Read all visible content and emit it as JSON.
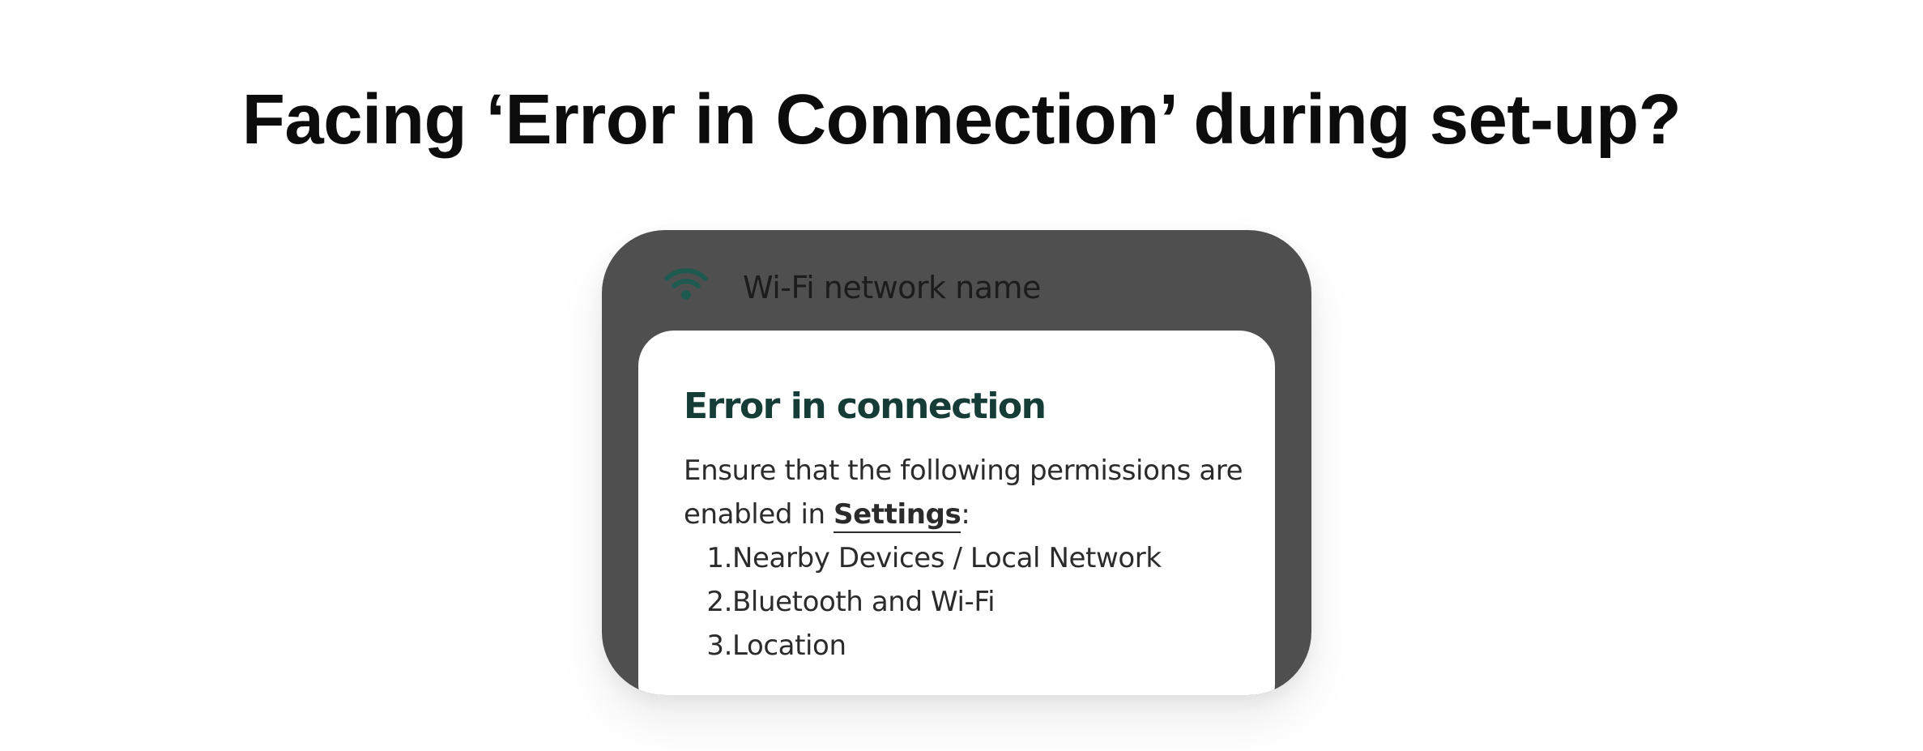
{
  "headline": "Facing ‘Error in Connection’ during set-up?",
  "network": {
    "icon": "wifi-icon",
    "name": "Wi-Fi network name"
  },
  "dialog": {
    "title": "Error in connection",
    "body_prefix": "Ensure that the following permissions are enabled in ",
    "settings_link": "Settings",
    "body_suffix": ":",
    "permissions": [
      {
        "number": "1.",
        "label": "Nearby Devices / Local Network"
      },
      {
        "number": "2.",
        "label": "Bluetooth and Wi-Fi"
      },
      {
        "number": "3.",
        "label": "Location"
      }
    ]
  },
  "colors": {
    "card_background": "#4f4f4f",
    "dialog_background": "#ffffff",
    "title_color": "#153c36",
    "wifi_icon_color": "#1f5a50",
    "text_color": "#2b2b2b"
  }
}
